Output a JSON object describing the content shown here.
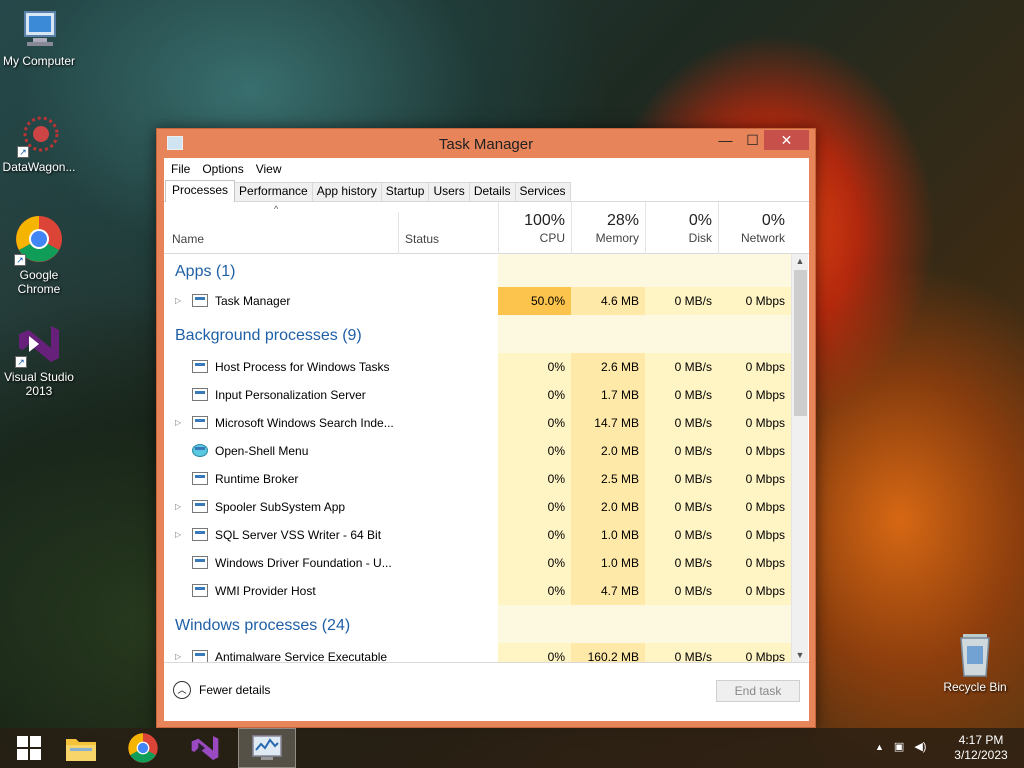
{
  "desktop": {
    "icons": [
      {
        "label": "My Computer"
      },
      {
        "label": "DataWagon..."
      },
      {
        "label": "Google Chrome"
      },
      {
        "label": "Visual Studio 2013"
      },
      {
        "label": "Recycle Bin"
      }
    ]
  },
  "window": {
    "title": "Task Manager",
    "controls": {
      "minimize": "—",
      "maximize": "☐",
      "close": "✕"
    },
    "menu": [
      "File",
      "Options",
      "View"
    ],
    "tabs": [
      "Processes",
      "Performance",
      "App history",
      "Startup",
      "Users",
      "Details",
      "Services"
    ],
    "active_tab": "Processes",
    "columns": {
      "name": "Name",
      "status": "Status",
      "cpu": {
        "pct": "100%",
        "label": "CPU"
      },
      "memory": {
        "pct": "28%",
        "label": "Memory"
      },
      "disk": {
        "pct": "0%",
        "label": "Disk"
      },
      "network": {
        "pct": "0%",
        "label": "Network"
      }
    },
    "groups": {
      "apps": "Apps (1)",
      "background": "Background processes (9)",
      "windows": "Windows processes (24)"
    },
    "apps": [
      {
        "name": "Task Manager",
        "cpu": "50.0%",
        "memory": "4.6 MB",
        "disk": "0 MB/s",
        "network": "0 Mbps"
      }
    ],
    "background": [
      {
        "name": "Host Process for Windows Tasks",
        "cpu": "0%",
        "memory": "2.6 MB",
        "disk": "0 MB/s",
        "network": "0 Mbps"
      },
      {
        "name": "Input Personalization Server",
        "cpu": "0%",
        "memory": "1.7 MB",
        "disk": "0 MB/s",
        "network": "0 Mbps"
      },
      {
        "name": "Microsoft Windows Search Inde...",
        "cpu": "0%",
        "memory": "14.7 MB",
        "disk": "0 MB/s",
        "network": "0 Mbps"
      },
      {
        "name": "Open-Shell Menu",
        "cpu": "0%",
        "memory": "2.0 MB",
        "disk": "0 MB/s",
        "network": "0 Mbps"
      },
      {
        "name": "Runtime Broker",
        "cpu": "0%",
        "memory": "2.5 MB",
        "disk": "0 MB/s",
        "network": "0 Mbps"
      },
      {
        "name": "Spooler SubSystem App",
        "cpu": "0%",
        "memory": "2.0 MB",
        "disk": "0 MB/s",
        "network": "0 Mbps"
      },
      {
        "name": "SQL Server VSS Writer - 64 Bit",
        "cpu": "0%",
        "memory": "1.0 MB",
        "disk": "0 MB/s",
        "network": "0 Mbps"
      },
      {
        "name": "Windows Driver Foundation - U...",
        "cpu": "0%",
        "memory": "1.0 MB",
        "disk": "0 MB/s",
        "network": "0 Mbps"
      },
      {
        "name": "WMI Provider Host",
        "cpu": "0%",
        "memory": "4.7 MB",
        "disk": "0 MB/s",
        "network": "0 Mbps"
      }
    ],
    "windows_partial": [
      {
        "name": "Antimalware Service Executable",
        "cpu": "0%",
        "memory": "160.2 MB",
        "disk": "0 MB/s",
        "network": "0 Mbps"
      }
    ],
    "footer": {
      "fewer_details": "Fewer details",
      "end_task": "End task"
    }
  },
  "taskbar": {
    "clock_time": "4:17 PM",
    "clock_date": "3/12/2023",
    "tray_expand": "▲"
  }
}
